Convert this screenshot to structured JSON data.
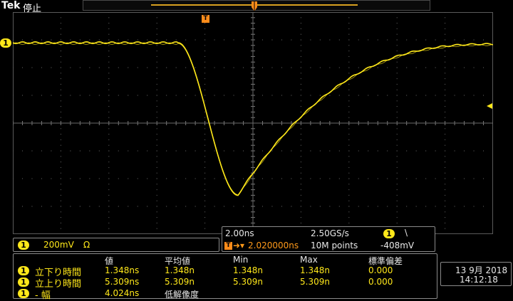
{
  "header": {
    "brand": "Tek",
    "status": "停止"
  },
  "channel": {
    "label": "1",
    "scale": "200mV",
    "coupling_symbol": "Ω",
    "color": "#ffe81a"
  },
  "timebase": {
    "horizontal_scale": "2.00ns",
    "sample_rate": "2.50GS/s",
    "trigger_position": "2.020000ns",
    "record_length": "10M points",
    "trigger_channel": "1",
    "trigger_slope_symbol": "\\",
    "trigger_level": "-408mV"
  },
  "measurements": {
    "headers": [
      "値",
      "平均値",
      "Min",
      "Max",
      "標準偏差"
    ],
    "rows": [
      {
        "channel": "1",
        "name": "立下り時間",
        "value": "1.348ns",
        "mean": "1.348n",
        "min": "1.348n",
        "max": "1.348n",
        "stdev": "0.000"
      },
      {
        "channel": "1",
        "name": "立上り時間",
        "value": "5.309ns",
        "mean": "5.309n",
        "min": "5.309n",
        "max": "5.309n",
        "stdev": "0.000"
      },
      {
        "channel": "1",
        "name": "- 幅",
        "value": "4.024ns",
        "mean": "低解像度",
        "min": "",
        "max": "",
        "stdev": ""
      }
    ]
  },
  "datetime": {
    "date": "13 9月 2018",
    "time": "14:12:18"
  },
  "colors": {
    "trace": "#ffe81a",
    "trigger": "#ff8c1a",
    "grid": "#5a5a5a"
  }
}
